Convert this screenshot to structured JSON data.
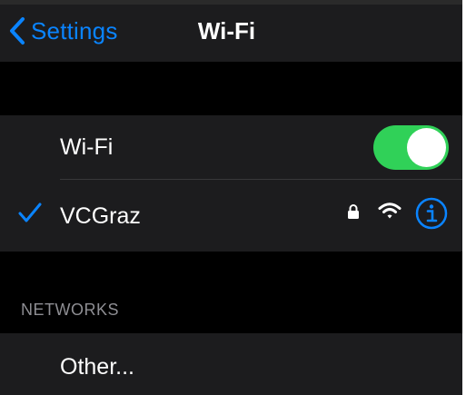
{
  "nav": {
    "back_label": "Settings",
    "title": "Wi-Fi"
  },
  "wifi_toggle": {
    "label": "Wi-Fi",
    "on": true
  },
  "connected_network": {
    "name": "VCGraz",
    "secured": true,
    "icons": [
      "checkmark-icon",
      "lock-icon",
      "wifi-signal-icon",
      "info-icon"
    ]
  },
  "networks_section": {
    "header": "NETWORKS",
    "items": [
      {
        "label": "Other..."
      }
    ]
  },
  "colors": {
    "accent": "#0a84ff",
    "toggle_on": "#30d158",
    "background": "#000000",
    "cell": "#1c1c1e",
    "secondary_text": "#8e8e93"
  }
}
